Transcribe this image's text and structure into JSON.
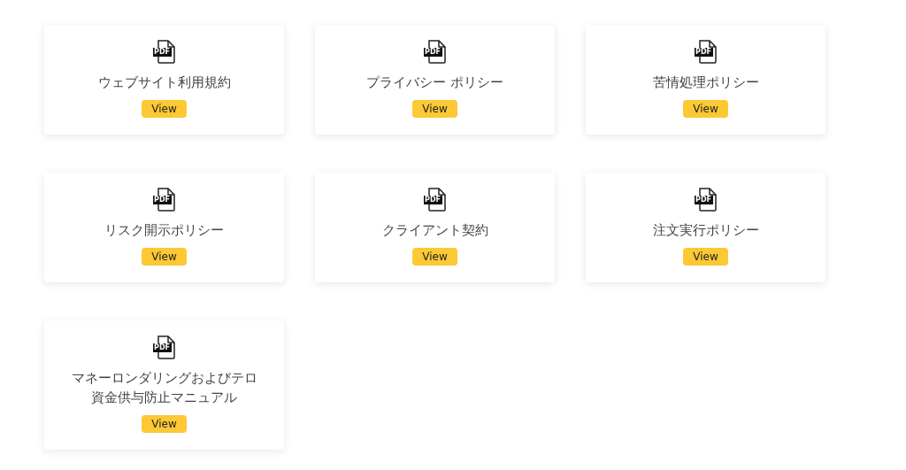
{
  "documents": [
    {
      "icon_label": "PDF",
      "title": "ウェブサイト利用規約",
      "button": "View"
    },
    {
      "icon_label": "PDF",
      "title": "プライバシー ポリシー",
      "button": "View"
    },
    {
      "icon_label": "PDF",
      "title": "苦情処理ポリシー",
      "button": "View"
    },
    {
      "icon_label": "PDF",
      "title": "リスク開示ポリシー",
      "button": "View"
    },
    {
      "icon_label": "PDF",
      "title": "クライアント契約",
      "button": "View"
    },
    {
      "icon_label": "PDF",
      "title": "注文実行ポリシー",
      "button": "View"
    },
    {
      "icon_label": "PDF",
      "title": "マネーロンダリングおよびテロ資金供与防止マニュアル",
      "button": "View"
    }
  ]
}
